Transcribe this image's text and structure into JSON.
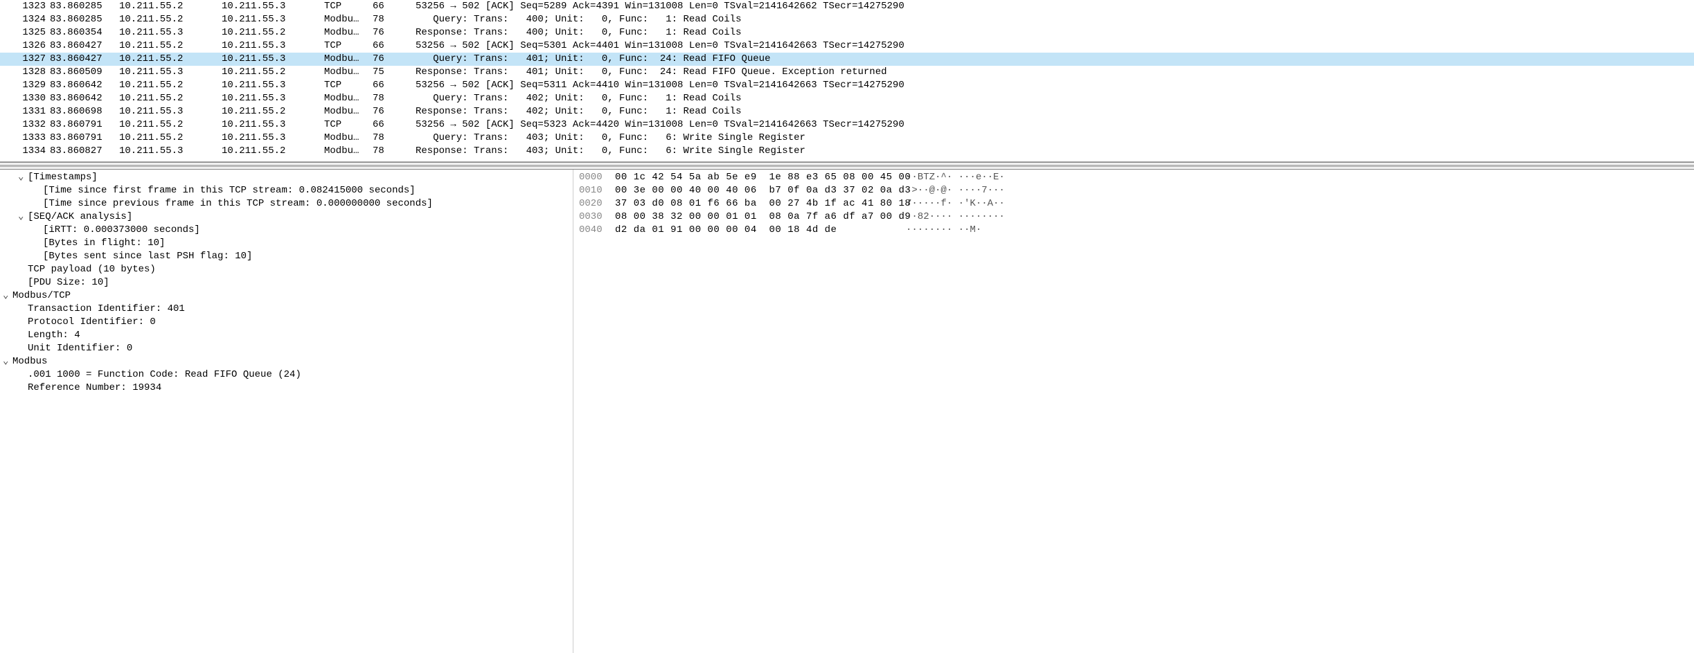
{
  "packets": [
    {
      "no": "1323",
      "time": "83.860285",
      "src": "10.211.55.2",
      "dst": "10.211.55.3",
      "proto": "TCP",
      "len": "66",
      "info": "53256 → 502 [ACK] Seq=5289 Ack=4391 Win=131008 Len=0 TSval=2141642662 TSecr=14275290",
      "selected": false
    },
    {
      "no": "1324",
      "time": "83.860285",
      "src": "10.211.55.2",
      "dst": "10.211.55.3",
      "proto": "Modbu…",
      "len": "78",
      "info": "   Query: Trans:   400; Unit:   0, Func:   1: Read Coils",
      "selected": false
    },
    {
      "no": "1325",
      "time": "83.860354",
      "src": "10.211.55.3",
      "dst": "10.211.55.2",
      "proto": "Modbu…",
      "len": "76",
      "info": "Response: Trans:   400; Unit:   0, Func:   1: Read Coils",
      "selected": false
    },
    {
      "no": "1326",
      "time": "83.860427",
      "src": "10.211.55.2",
      "dst": "10.211.55.3",
      "proto": "TCP",
      "len": "66",
      "info": "53256 → 502 [ACK] Seq=5301 Ack=4401 Win=131008 Len=0 TSval=2141642663 TSecr=14275290",
      "selected": false
    },
    {
      "no": "1327",
      "time": "83.860427",
      "src": "10.211.55.2",
      "dst": "10.211.55.3",
      "proto": "Modbu…",
      "len": "76",
      "info": "   Query: Trans:   401; Unit:   0, Func:  24: Read FIFO Queue",
      "selected": true
    },
    {
      "no": "1328",
      "time": "83.860509",
      "src": "10.211.55.3",
      "dst": "10.211.55.2",
      "proto": "Modbu…",
      "len": "75",
      "info": "Response: Trans:   401; Unit:   0, Func:  24: Read FIFO Queue. Exception returned",
      "selected": false
    },
    {
      "no": "1329",
      "time": "83.860642",
      "src": "10.211.55.2",
      "dst": "10.211.55.3",
      "proto": "TCP",
      "len": "66",
      "info": "53256 → 502 [ACK] Seq=5311 Ack=4410 Win=131008 Len=0 TSval=2141642663 TSecr=14275290",
      "selected": false
    },
    {
      "no": "1330",
      "time": "83.860642",
      "src": "10.211.55.2",
      "dst": "10.211.55.3",
      "proto": "Modbu…",
      "len": "78",
      "info": "   Query: Trans:   402; Unit:   0, Func:   1: Read Coils",
      "selected": false
    },
    {
      "no": "1331",
      "time": "83.860698",
      "src": "10.211.55.3",
      "dst": "10.211.55.2",
      "proto": "Modbu…",
      "len": "76",
      "info": "Response: Trans:   402; Unit:   0, Func:   1: Read Coils",
      "selected": false
    },
    {
      "no": "1332",
      "time": "83.860791",
      "src": "10.211.55.2",
      "dst": "10.211.55.3",
      "proto": "TCP",
      "len": "66",
      "info": "53256 → 502 [ACK] Seq=5323 Ack=4420 Win=131008 Len=0 TSval=2141642663 TSecr=14275290",
      "selected": false
    },
    {
      "no": "1333",
      "time": "83.860791",
      "src": "10.211.55.2",
      "dst": "10.211.55.3",
      "proto": "Modbu…",
      "len": "78",
      "info": "   Query: Trans:   403; Unit:   0, Func:   6: Write Single Register",
      "selected": false
    },
    {
      "no": "1334",
      "time": "83.860827",
      "src": "10.211.55.3",
      "dst": "10.211.55.2",
      "proto": "Modbu…",
      "len": "78",
      "info": "Response: Trans:   403; Unit:   0, Func:   6: Write Single Register",
      "selected": false
    }
  ],
  "tree": [
    {
      "indent": 1,
      "twisty": "v",
      "text": "[Timestamps]"
    },
    {
      "indent": 2,
      "twisty": "",
      "text": "[Time since first frame in this TCP stream: 0.082415000 seconds]"
    },
    {
      "indent": 2,
      "twisty": "",
      "text": "[Time since previous frame in this TCP stream: 0.000000000 seconds]"
    },
    {
      "indent": 1,
      "twisty": "v",
      "text": "[SEQ/ACK analysis]"
    },
    {
      "indent": 2,
      "twisty": "",
      "text": "[iRTT: 0.000373000 seconds]"
    },
    {
      "indent": 2,
      "twisty": "",
      "text": "[Bytes in flight: 10]"
    },
    {
      "indent": 2,
      "twisty": "",
      "text": "[Bytes sent since last PSH flag: 10]"
    },
    {
      "indent": 1,
      "twisty": "",
      "text": "TCP payload (10 bytes)"
    },
    {
      "indent": 1,
      "twisty": "",
      "text": "[PDU Size: 10]"
    },
    {
      "indent": 0,
      "twisty": "v",
      "text": "Modbus/TCP"
    },
    {
      "indent": 1,
      "twisty": "",
      "text": "Transaction Identifier: 401"
    },
    {
      "indent": 1,
      "twisty": "",
      "text": "Protocol Identifier: 0"
    },
    {
      "indent": 1,
      "twisty": "",
      "text": "Length: 4"
    },
    {
      "indent": 1,
      "twisty": "",
      "text": "Unit Identifier: 0"
    },
    {
      "indent": 0,
      "twisty": "v",
      "text": "Modbus"
    },
    {
      "indent": 1,
      "twisty": "",
      "text": ".001 1000 = Function Code: Read FIFO Queue (24)"
    },
    {
      "indent": 1,
      "twisty": "",
      "text": "Reference Number: 19934"
    }
  ],
  "hex": [
    {
      "off": "0000",
      "bytes": "00 1c 42 54 5a ab 5e e9  1e 88 e3 65 08 00 45 00",
      "ascii": "··BTZ·^· ···e··E·"
    },
    {
      "off": "0010",
      "bytes": "00 3e 00 00 40 00 40 06  b7 0f 0a d3 37 02 0a d3",
      "ascii": "·>··@·@· ····7···"
    },
    {
      "off": "0020",
      "bytes": "37 03 d0 08 01 f6 66 ba  00 27 4b 1f ac 41 80 18",
      "ascii": "7·····f· ·'K··A··"
    },
    {
      "off": "0030",
      "bytes": "08 00 38 32 00 00 01 01  08 0a 7f a6 df a7 00 d9",
      "ascii": "··82···· ········"
    },
    {
      "off": "0040",
      "bytes": "d2 da 01 91 00 00 00 04  00 18 4d de",
      "ascii": "········ ··M·"
    }
  ]
}
